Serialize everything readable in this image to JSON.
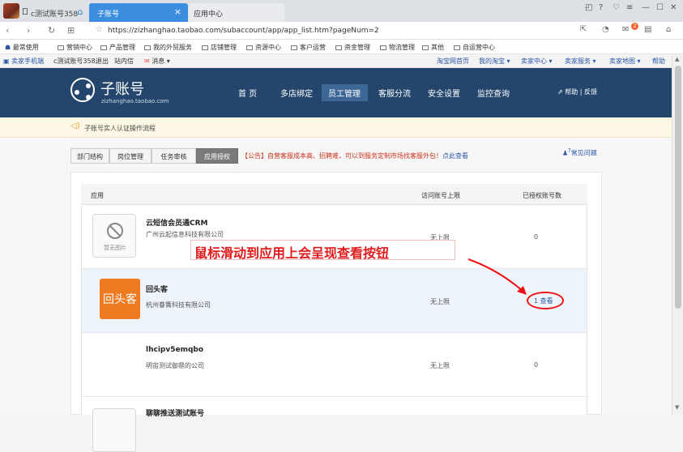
{
  "browser": {
    "tabs": [
      {
        "label": "c测试账号358"
      },
      {
        "label": "子账号"
      },
      {
        "label": "应用中心"
      }
    ],
    "close_glyph": "×",
    "url": "https://zizhanghao.taobao.com/subaccount/app/app_list.htm?pageNum=2",
    "notification_count": "2",
    "bookmarks": [
      "最常使用",
      "营销中心",
      "产品管理",
      "我的外贸服务",
      "店铺管理",
      "资源中心",
      "客户运营",
      "资金管理",
      "物流管理",
      "其他",
      "自运营中心"
    ]
  },
  "taobao_bar": {
    "mobile": "卖家手机端",
    "user": "c测试账号358,",
    "logout": "退出",
    "inbox": "站内信",
    "message": "消息",
    "links": [
      "淘宝网首页",
      "我的淘宝 ▾",
      "卖家中心 ▾",
      "卖家服务 ▾",
      "卖家地图 ▾",
      "帮助"
    ]
  },
  "header": {
    "title": "子账号",
    "subtitle": "zizhanghao.taobao.com",
    "nav": [
      "首 页",
      "多店绑定",
      "员工管理",
      "客服分流",
      "安全设置",
      "监控查询"
    ],
    "help": "帮助 | 反馈"
  },
  "notice": {
    "text": "子账号实人认证操作流程"
  },
  "subtabs": [
    "部门结构",
    "岗位管理",
    "任务审核",
    "应用授权"
  ],
  "announcement": {
    "text": "【公告】自营客服成本高、招聘难，可以到服务定制市场找客服外包！",
    "link": "点此查看"
  },
  "faq": "常见问题",
  "table": {
    "headers": [
      "应用",
      "访问账号上限",
      "已授权账号数"
    ],
    "rows": [
      {
        "name": "云短信会员通CRM",
        "company": "广州云起信息科技有限公司",
        "limit": "无上限",
        "count": "0",
        "no_image": "暂无图片"
      },
      {
        "name": "回头客",
        "company": "杭州眷簀科技有限公司",
        "limit": "无上限",
        "count": "1",
        "view": "查看",
        "logo_text": "回头客"
      },
      {
        "name": "lhcipv5emqbo",
        "company": "明宙测试御鼎的公司",
        "limit": "无上限",
        "count": "0"
      },
      {
        "name": "聊聊推送测试账号"
      }
    ]
  },
  "annotation": "鼠标滑动到应用上会呈现查看按钮",
  "colors": {
    "header_bg": "#24466d",
    "accent_blue": "#3b8de0",
    "annotation_red": "#e01b1b",
    "logo_orange": "#f07a21"
  }
}
